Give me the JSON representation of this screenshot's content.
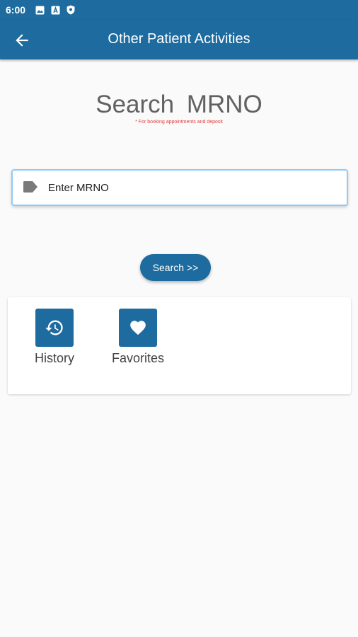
{
  "status_bar": {
    "time": "6:00",
    "icons": [
      "image-icon",
      "translate-icon",
      "shield-icon"
    ]
  },
  "app_bar": {
    "title": "Other Patient Activities",
    "back_icon": "arrow-left-icon",
    "color": "#1d6b9f"
  },
  "search": {
    "title": "Search  MRNO",
    "note": "* For booking appointments and deposit",
    "input_placeholder": "Enter MRNO",
    "input_value": "",
    "field_icon": "label-icon",
    "button_label": "Search >>"
  },
  "activities": [
    {
      "label": "History",
      "icon": "history-icon"
    },
    {
      "label": "Favorites",
      "icon": "heart-icon"
    }
  ],
  "colors": {
    "primary": "#1d6b9f",
    "note_red": "#e53935",
    "background": "#fafafa"
  }
}
